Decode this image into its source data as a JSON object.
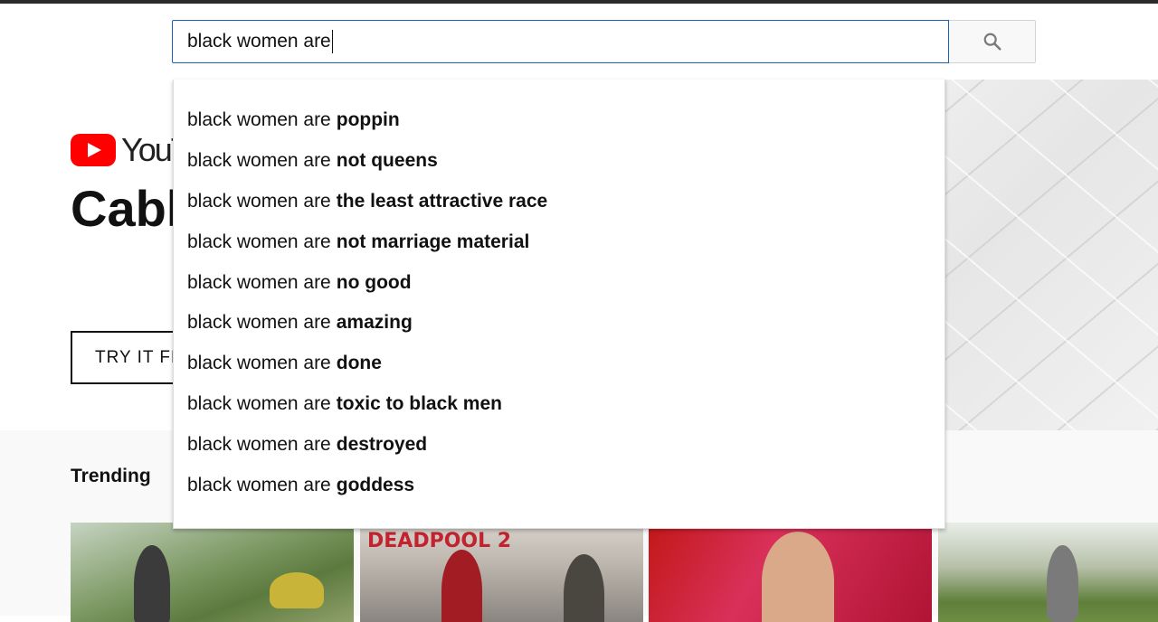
{
  "search": {
    "value": "black women are",
    "button_icon": "search-icon"
  },
  "hero": {
    "logo_text": "YouT",
    "title": "Cabl",
    "try_button": "TRY IT FR"
  },
  "trending": {
    "label": "Trending",
    "thumbnail_2_text": "DEADPOOL 2"
  },
  "suggestions": [
    {
      "prefix": "black women are",
      "completion": "poppin"
    },
    {
      "prefix": "black women are",
      "completion": "not queens"
    },
    {
      "prefix": "black women are",
      "completion": "the least attractive race"
    },
    {
      "prefix": "black women are",
      "completion": "not marriage material"
    },
    {
      "prefix": "black women are",
      "completion": "no good"
    },
    {
      "prefix": "black women are",
      "completion": "amazing"
    },
    {
      "prefix": "black women are",
      "completion": "done"
    },
    {
      "prefix": "black women are",
      "completion": "toxic to black men"
    },
    {
      "prefix": "black women are",
      "completion": "destroyed"
    },
    {
      "prefix": "black women are",
      "completion": "goddess"
    }
  ],
  "colors": {
    "brand_red": "#ff0000",
    "input_focus": "#1c62b9"
  }
}
